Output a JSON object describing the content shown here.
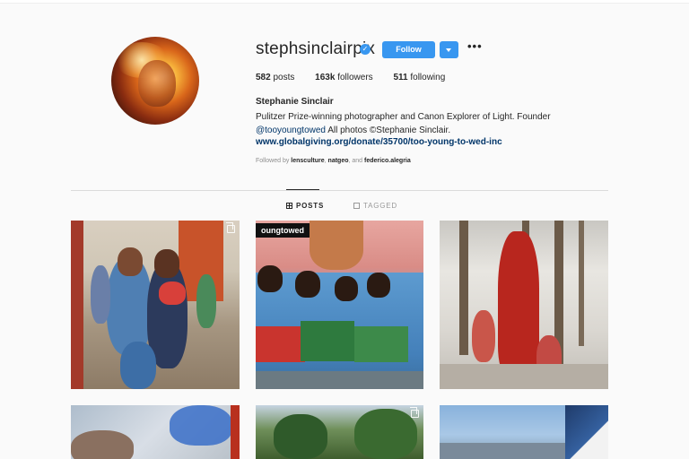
{
  "profile": {
    "username": "stephsinclairpix",
    "follow_label": "Follow",
    "more_label": "•••",
    "verified_mark": "✓",
    "stats": [
      {
        "count": "582",
        "label": "posts"
      },
      {
        "count": "163k",
        "label": "followers"
      },
      {
        "count": "511",
        "label": "following"
      }
    ],
    "full_name": "Stephanie Sinclair",
    "bio_line1": "Pulitzer Prize-winning photographer and Canon Explorer of Light. Founder",
    "bio_mention": "@tooyoungtowed",
    "bio_line2_rest": " All photos ©Stephanie Sinclair.",
    "website": "www.globalgiving.org/donate/35700/too-young-to-wed-inc",
    "followed_by_prefix": "Followed by ",
    "followed_by_users": [
      "lensculture",
      "natgeo",
      "federico.alegria"
    ],
    "followed_by_sep": ", ",
    "followed_by_and": ", and "
  },
  "tabs": [
    {
      "label": "POSTS",
      "active": true
    },
    {
      "label": "TAGGED",
      "active": false
    }
  ],
  "posts": [
    {
      "overlay_text": ""
    },
    {
      "overlay_text": "oungtowed"
    },
    {
      "overlay_text": ""
    }
  ],
  "colors": {
    "accent": "#3897f0",
    "link": "#003569",
    "muted": "#8e8e8e"
  }
}
